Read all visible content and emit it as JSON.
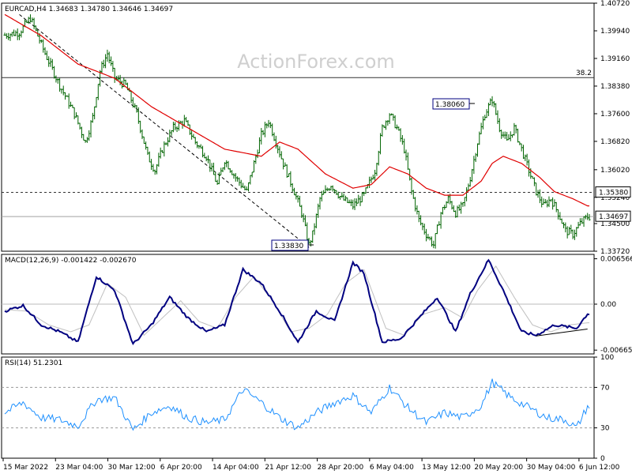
{
  "chart_data": [
    {
      "type": "candlestick",
      "title": "EURCAD,H4  1.34683 1.34780 1.34646 1.34697",
      "watermark": "ActionForex.com",
      "ylim": [
        1.3372,
        1.4072
      ],
      "y_ticks": [
        "1.40720",
        "1.39940",
        "1.39160",
        "1.38380",
        "1.37600",
        "1.36820",
        "1.36020",
        "1.35240",
        "1.34500",
        "1.33720"
      ],
      "x_ticks": [
        "15 Mar 2022",
        "23 Mar 04:00",
        "30 Mar 12:00",
        "6 Apr 20:00",
        "14 Apr 04:00",
        "21 Apr 12:00",
        "28 Apr 20:00",
        "6 May 04:00",
        "13 May 12:00",
        "20 May 20:00",
        "30 May 04:00",
        "6 Jun 12:00"
      ],
      "close_path_keypoints": [
        [
          0,
          1.3982
        ],
        [
          8,
          1.399
        ],
        [
          14,
          1.403
        ],
        [
          22,
          1.393
        ],
        [
          30,
          1.384
        ],
        [
          38,
          1.376
        ],
        [
          44,
          1.368
        ],
        [
          48,
          1.375
        ],
        [
          52,
          1.388
        ],
        [
          56,
          1.393
        ],
        [
          60,
          1.386
        ],
        [
          66,
          1.384
        ],
        [
          72,
          1.376
        ],
        [
          78,
          1.364
        ],
        [
          82,
          1.36
        ],
        [
          86,
          1.366
        ],
        [
          92,
          1.372
        ],
        [
          98,
          1.374
        ],
        [
          104,
          1.368
        ],
        [
          110,
          1.364
        ],
        [
          116,
          1.356
        ],
        [
          120,
          1.363
        ],
        [
          126,
          1.358
        ],
        [
          132,
          1.354
        ],
        [
          136,
          1.362
        ],
        [
          140,
          1.37
        ],
        [
          144,
          1.374
        ],
        [
          148,
          1.368
        ],
        [
          152,
          1.362
        ],
        [
          158,
          1.354
        ],
        [
          162,
          1.348
        ],
        [
          166,
          1.339
        ],
        [
          168,
          1.342
        ],
        [
          172,
          1.352
        ],
        [
          178,
          1.356
        ],
        [
          184,
          1.352
        ],
        [
          190,
          1.35
        ],
        [
          196,
          1.353
        ],
        [
          202,
          1.36
        ],
        [
          206,
          1.372
        ],
        [
          210,
          1.376
        ],
        [
          214,
          1.372
        ],
        [
          218,
          1.366
        ],
        [
          222,
          1.354
        ],
        [
          226,
          1.346
        ],
        [
          230,
          1.342
        ],
        [
          234,
          1.339
        ],
        [
          238,
          1.348
        ],
        [
          242,
          1.352
        ],
        [
          246,
          1.348
        ],
        [
          250,
          1.35
        ],
        [
          254,
          1.358
        ],
        [
          258,
          1.368
        ],
        [
          262,
          1.376
        ],
        [
          266,
          1.38
        ],
        [
          270,
          1.372
        ],
        [
          274,
          1.368
        ],
        [
          278,
          1.372
        ],
        [
          282,
          1.366
        ],
        [
          286,
          1.36
        ],
        [
          290,
          1.354
        ],
        [
          294,
          1.35
        ],
        [
          298,
          1.352
        ],
        [
          302,
          1.348
        ],
        [
          306,
          1.343
        ],
        [
          310,
          1.342
        ],
        [
          314,
          1.345
        ],
        [
          318,
          1.3469
        ]
      ],
      "candle_count": 320,
      "high_label": "1.38060",
      "low_label": "1.33830",
      "lines": [
        {
          "name": "38.2",
          "value": 1.3862,
          "style": "solid"
        },
        {
          "name": "1.35380",
          "value": 1.3538,
          "style": "dashed"
        },
        {
          "name": "1.34697",
          "value": 1.34697,
          "style": "solid-gray"
        }
      ],
      "ma_keypoints": [
        [
          0,
          1.404
        ],
        [
          20,
          1.398
        ],
        [
          40,
          1.39
        ],
        [
          60,
          1.386
        ],
        [
          80,
          1.378
        ],
        [
          100,
          1.372
        ],
        [
          120,
          1.366
        ],
        [
          140,
          1.364
        ],
        [
          150,
          1.368
        ],
        [
          160,
          1.366
        ],
        [
          175,
          1.359
        ],
        [
          190,
          1.355
        ],
        [
          200,
          1.356
        ],
        [
          210,
          1.361
        ],
        [
          220,
          1.359
        ],
        [
          230,
          1.355
        ],
        [
          240,
          1.353
        ],
        [
          250,
          1.353
        ],
        [
          260,
          1.357
        ],
        [
          266,
          1.362
        ],
        [
          272,
          1.364
        ],
        [
          282,
          1.362
        ],
        [
          292,
          1.358
        ],
        [
          300,
          1.354
        ],
        [
          310,
          1.352
        ],
        [
          318,
          1.35
        ]
      ],
      "trendline_label": "downtrend from 1.40720 to 1.33830"
    },
    {
      "type": "line",
      "title": "MACD(12,26,9) -0.001422 -0.002670",
      "ylim": [
        -0.0072,
        0.0072
      ],
      "y_ticks": [
        "0.006566",
        "0.00",
        "-0.00665"
      ],
      "macd_keypoints": [
        [
          0,
          -0.001
        ],
        [
          10,
          -0.0002
        ],
        [
          20,
          -0.003
        ],
        [
          30,
          -0.004
        ],
        [
          40,
          -0.0055
        ],
        [
          50,
          0.004
        ],
        [
          60,
          0.002
        ],
        [
          70,
          -0.0058
        ],
        [
          80,
          -0.003
        ],
        [
          90,
          0.001
        ],
        [
          100,
          -0.002
        ],
        [
          110,
          -0.004
        ],
        [
          120,
          -0.003
        ],
        [
          130,
          0.005
        ],
        [
          140,
          0.003
        ],
        [
          150,
          -0.001
        ],
        [
          160,
          -0.0055
        ],
        [
          170,
          -0.001
        ],
        [
          180,
          -0.0025
        ],
        [
          190,
          0.006
        ],
        [
          196,
          0.0045
        ],
        [
          206,
          -0.0055
        ],
        [
          216,
          -0.005
        ],
        [
          226,
          -0.002
        ],
        [
          236,
          0.001
        ],
        [
          246,
          -0.004
        ],
        [
          254,
          0.0015
        ],
        [
          264,
          0.0064
        ],
        [
          272,
          0.002
        ],
        [
          282,
          -0.004
        ],
        [
          290,
          -0.0045
        ],
        [
          300,
          -0.003
        ],
        [
          312,
          -0.0035
        ],
        [
          318,
          -0.0014
        ]
      ],
      "signal_keypoints": [
        [
          0,
          -0.0008
        ],
        [
          12,
          -0.001
        ],
        [
          24,
          -0.003
        ],
        [
          36,
          -0.004
        ],
        [
          46,
          -0.003
        ],
        [
          56,
          0.003
        ],
        [
          66,
          0.001
        ],
        [
          76,
          -0.0045
        ],
        [
          86,
          -0.002
        ],
        [
          96,
          0.0005
        ],
        [
          106,
          -0.0025
        ],
        [
          116,
          -0.0035
        ],
        [
          126,
          0.001
        ],
        [
          136,
          0.004
        ],
        [
          146,
          0.0005
        ],
        [
          156,
          -0.004
        ],
        [
          166,
          -0.0035
        ],
        [
          176,
          -0.0015
        ],
        [
          186,
          0.003
        ],
        [
          196,
          0.005
        ],
        [
          208,
          -0.0035
        ],
        [
          218,
          -0.0045
        ],
        [
          228,
          -0.0015
        ],
        [
          240,
          -0.0005
        ],
        [
          250,
          -0.002
        ],
        [
          258,
          0.002
        ],
        [
          268,
          0.0055
        ],
        [
          278,
          0.001
        ],
        [
          288,
          -0.003
        ],
        [
          298,
          -0.004
        ],
        [
          308,
          -0.003
        ],
        [
          318,
          -0.0027
        ]
      ]
    },
    {
      "type": "line",
      "title": "RSI(14) 51.2301",
      "ylim": [
        0,
        100
      ],
      "y_ticks": [
        "100",
        "70",
        "30",
        "0"
      ],
      "levels": [
        70,
        30
      ],
      "rsi_keypoints": [
        [
          0,
          45
        ],
        [
          10,
          55
        ],
        [
          20,
          40
        ],
        [
          30,
          38
        ],
        [
          40,
          32
        ],
        [
          50,
          58
        ],
        [
          60,
          60
        ],
        [
          70,
          28
        ],
        [
          80,
          45
        ],
        [
          90,
          52
        ],
        [
          100,
          40
        ],
        [
          110,
          35
        ],
        [
          120,
          38
        ],
        [
          130,
          68
        ],
        [
          140,
          55
        ],
        [
          150,
          40
        ],
        [
          160,
          30
        ],
        [
          170,
          45
        ],
        [
          180,
          55
        ],
        [
          190,
          62
        ],
        [
          200,
          45
        ],
        [
          210,
          70
        ],
        [
          220,
          50
        ],
        [
          230,
          35
        ],
        [
          240,
          45
        ],
        [
          250,
          40
        ],
        [
          260,
          52
        ],
        [
          266,
          75
        ],
        [
          276,
          60
        ],
        [
          286,
          50
        ],
        [
          296,
          40
        ],
        [
          306,
          38
        ],
        [
          312,
          30
        ],
        [
          318,
          51
        ]
      ]
    }
  ]
}
